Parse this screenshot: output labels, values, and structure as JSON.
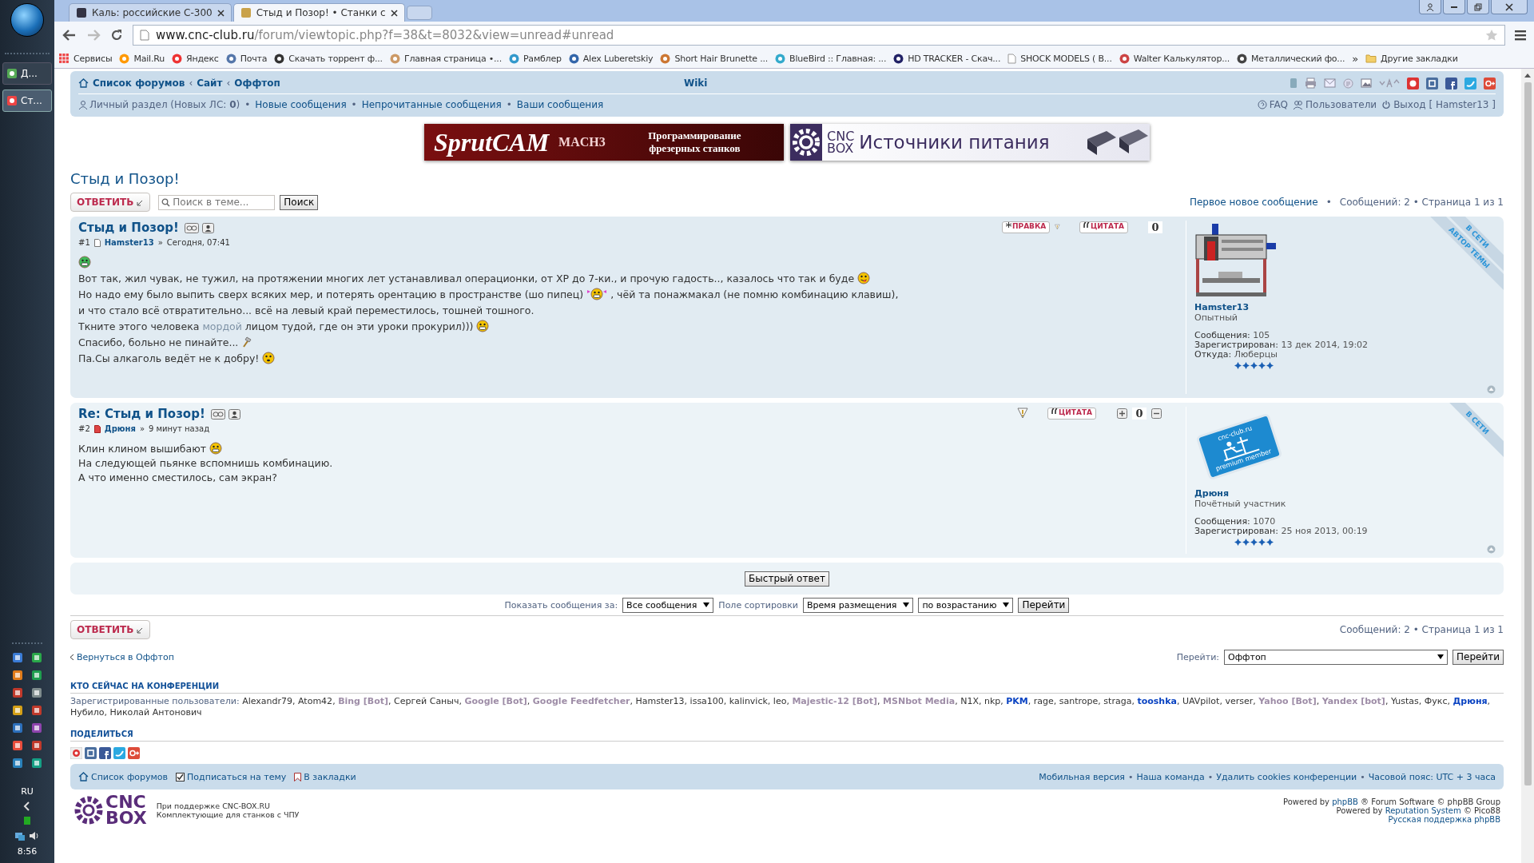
{
  "taskbar": {
    "buttons": [
      {
        "label": "Д...",
        "selected": false
      },
      {
        "label": "Ст...",
        "selected": true
      }
    ],
    "language": "RU",
    "clock": "8:56"
  },
  "browser": {
    "tabs": [
      {
        "title": "Каль: российские С-300",
        "selected": false
      },
      {
        "title": "Стыд и Позор! • Станки с",
        "selected": true
      }
    ],
    "url_host": "www.cnc-club.ru",
    "url_path": "/forum/viewtopic.php?f=38&t=8032&view=unread#unread",
    "bookmarks": [
      {
        "label": "Сервисы",
        "kind": "apps"
      },
      {
        "label": "Mail.Ru",
        "kind": "site"
      },
      {
        "label": "Яндекс",
        "kind": "site"
      },
      {
        "label": "Почта",
        "kind": "site"
      },
      {
        "label": "Скачать торрент ф...",
        "kind": "site"
      },
      {
        "label": "Главная страница •...",
        "kind": "site"
      },
      {
        "label": "Рамблер",
        "kind": "site"
      },
      {
        "label": "Alex Luberetskiy",
        "kind": "site"
      },
      {
        "label": "Short Hair Brunette ...",
        "kind": "site"
      },
      {
        "label": "BlueBird :: Главная: ...",
        "kind": "site"
      },
      {
        "label": "HD TRACKER - Скач...",
        "kind": "site"
      },
      {
        "label": "SHOCK MODELS ( B...",
        "kind": "page"
      },
      {
        "label": "Walter Калькулятор...",
        "kind": "site"
      },
      {
        "label": "Металлический фо...",
        "kind": "site"
      }
    ],
    "bookmarks_overflow": "»",
    "other_bookmarks": "Другие закладки"
  },
  "navbar": {
    "breadcrumbs": [
      "Список форумов",
      "Сайт",
      "Оффтоп"
    ],
    "breadcrumb_separator": "‹",
    "wiki": "Wiki",
    "personal": "Личный раздел (Новых ЛС: **0**)",
    "links": [
      "Новые сообщения",
      "Непрочитанные сообщения",
      "Ваши сообщения"
    ],
    "separator": "•",
    "right_links": [
      {
        "label": "FAQ",
        "kind": "faq"
      },
      {
        "label": "Пользователи",
        "kind": "users"
      },
      {
        "label": "Выход [ Hamster13 ]",
        "kind": "logout"
      }
    ]
  },
  "banners": [
    {
      "kind": "sprutcam",
      "lines": [
        "SprutCAM",
        "MACH3",
        "Программирование",
        "фрезерных станков"
      ]
    },
    {
      "kind": "cncbox",
      "lines": [
        "CNC",
        "BOX",
        "Источники питания"
      ]
    }
  ],
  "topic": {
    "title": "Стыд и Позор!",
    "reply_button": "ОТВЕТИТЬ",
    "search_placeholder": "Поиск в теме...",
    "search_button": "Поиск",
    "first_new": "Первое новое сообщение",
    "info": "Сообщений: 2 • Страница 1 из 1"
  },
  "posts": [
    {
      "title": "Стыд и Позор!",
      "number": "#1",
      "unread": false,
      "author": "Hamster13",
      "separator": "»",
      "time": "Сегодня, 07:41",
      "edit_button": "ПРАВКА",
      "quote_button": "ЦИТАТА",
      "rating": "0",
      "vote_buttons": false,
      "body": [
        [
          {
            "kind": "smiley-green"
          }
        ],
        [
          {
            "kind": "text",
            "text": "Вот так, жил чувак, не тужил, на протяжении многих лет устанавливал операционки, от XP до 7-ки., и прочую гадость.., казалось что так и буде"
          },
          {
            "kind": "smiley-tongue"
          }
        ],
        [
          {
            "kind": "text",
            "text": "Но надо ему было выпить сверх всяких мер, и потерять орентацию в пространстве (шо пипец)"
          },
          {
            "kind": "smiley-girl"
          },
          {
            "kind": "text",
            "text": ", чёй та понажмакал (не помню комбинацию клавиш),"
          }
        ],
        [
          {
            "kind": "text",
            "text": "и что стало всё отвратительно... всё на левый край переместилось, тошней тошного."
          }
        ],
        [
          {
            "kind": "text",
            "text": "Ткните этого человека"
          },
          {
            "kind": "hidden",
            "text": "мордой"
          },
          {
            "kind": "text",
            "text": "лицом тудой, где он эти уроки прокурил)))"
          },
          {
            "kind": "smiley-grin"
          }
        ],
        [
          {
            "kind": "text",
            "text": "Спасибо, больно не пинайте..."
          },
          {
            "kind": "hammer"
          }
        ],
        [
          {
            "kind": "text",
            "text": "Па.Сы алкаголь ведёт не к добру!"
          },
          {
            "kind": "smiley-tipsy"
          }
        ]
      ],
      "avatar": {
        "kind": "machine"
      },
      "profile_name": "Hamster13",
      "rank": "Опытный",
      "stats": [
        {
          "label": "Сообщения:",
          "value": "105"
        },
        {
          "label": "Зарегистрирован:",
          "value": "13 дек 2014, 19:02"
        },
        {
          "label": "Откуда:",
          "value": "Люберцы"
        }
      ],
      "stars": 5,
      "ribbons": [
        "В СЕТИ",
        "АВТОР ТЕМЫ"
      ]
    },
    {
      "title": "Re: Стыд и Позор!",
      "number": "#2",
      "unread": true,
      "author": "Дрюня",
      "separator": "»",
      "time": "9 минут назад",
      "quote_button": "ЦИТАТА",
      "rating": "0",
      "vote_buttons": true,
      "body": [
        [
          {
            "kind": "text",
            "text": "Клин клином вышибают"
          },
          {
            "kind": "smiley-grin"
          }
        ],
        [
          {
            "kind": "text",
            "text": "На следующей пьянке вспомнишь комбинацию."
          }
        ],
        [
          {
            "kind": "text",
            "text": "А что именно сместилось, сам экран?"
          }
        ]
      ],
      "avatar": {
        "kind": "badge",
        "lines": [
          "cnc-club.ru",
          "premium member"
        ]
      },
      "profile_name": "Дрюня",
      "rank": "Почётный участник",
      "stats": [
        {
          "label": "Сообщения:",
          "value": "1070"
        },
        {
          "label": "Зарегистрирован:",
          "value": "25 ноя 2013, 00:19"
        }
      ],
      "stars": 5,
      "ribbons": [
        "В СЕТИ"
      ]
    }
  ],
  "quick_reply": "Быстрый ответ",
  "sorting": {
    "show_label": "Показать сообщения за:",
    "show_value": "Все сообщения",
    "sort_label": "Поле сортировки",
    "sort_value": "Время размещения",
    "order_value": "по возрастанию",
    "go_button": "Перейти"
  },
  "bottom": {
    "reply_button": "ОТВЕТИТЬ",
    "info": "Сообщений: 2 • Страница 1 из 1",
    "back_link": "Вернуться в Оффтоп",
    "jump_label": "Перейти:",
    "jump_value": "Оффтоп",
    "jump_button": "Перейти"
  },
  "online": {
    "title": "КТО СЕЙЧАС НА КОНФЕРЕНЦИИ",
    "label": "Зарегистрированные пользователи:",
    "separator": ",",
    "users": [
      {
        "name": "Alexandr79",
        "kind": "user"
      },
      {
        "name": "Atom42",
        "kind": "user"
      },
      {
        "name": "Bing [Bot]",
        "kind": "bot"
      },
      {
        "name": "Сергей Саныч",
        "kind": "user"
      },
      {
        "name": "Google [Bot]",
        "kind": "bot"
      },
      {
        "name": "Google Feedfetcher",
        "kind": "bot"
      },
      {
        "name": "Hamster13",
        "kind": "user"
      },
      {
        "name": "issa100",
        "kind": "user"
      },
      {
        "name": "kalinvick",
        "kind": "user"
      },
      {
        "name": "leo",
        "kind": "user"
      },
      {
        "name": "Majestic-12 [Bot]",
        "kind": "bot"
      },
      {
        "name": "MSNbot Media",
        "kind": "bot"
      },
      {
        "name": "N1X",
        "kind": "user"
      },
      {
        "name": "nkp",
        "kind": "user"
      },
      {
        "name": "PKM",
        "kind": "staff"
      },
      {
        "name": "rage",
        "kind": "user"
      },
      {
        "name": "santrope",
        "kind": "user"
      },
      {
        "name": "straga",
        "kind": "user"
      },
      {
        "name": "tooshka",
        "kind": "staff"
      },
      {
        "name": "UAVpilot",
        "kind": "user"
      },
      {
        "name": "verser",
        "kind": "user"
      },
      {
        "name": "Yahoo [Bot]",
        "kind": "bot"
      },
      {
        "name": "Yandex [bot]",
        "kind": "bot"
      },
      {
        "name": "Yustas",
        "kind": "user"
      },
      {
        "name": "Фукс",
        "kind": "user"
      },
      {
        "name": "Дрюня",
        "kind": "staff"
      },
      {
        "name": "Нубило",
        "kind": "user"
      },
      {
        "name": "Николай Антонович",
        "kind": "user"
      }
    ]
  },
  "share": {
    "title": "ПОДЕЛИТЬСЯ"
  },
  "footer_nav": {
    "left": [
      {
        "label": "Список форумов",
        "kind": "home"
      },
      {
        "label": "Подписаться на тему",
        "kind": "checkbox"
      },
      {
        "label": "В закладки",
        "kind": "bookmark"
      }
    ],
    "right": [
      "Мобильная версия",
      "Наша команда",
      "Удалить cookies конференции",
      "Часовой пояс: UTC + 3 часа"
    ],
    "separator": "•"
  },
  "footer": {
    "logo": [
      "CNC",
      "BOX"
    ],
    "support": "При поддержке CNC-BOX.RU",
    "tagline": "Комплектующие для станков с ЧПУ",
    "credits": [
      {
        "before": "Powered by",
        "link": "phpBB",
        "after": "® Forum Software © phpBB Group"
      },
      {
        "before": "Powered by",
        "link": "Reputation System",
        "after": "© Pico88"
      }
    ],
    "russian_support": "Русская поддержка phpBB"
  }
}
